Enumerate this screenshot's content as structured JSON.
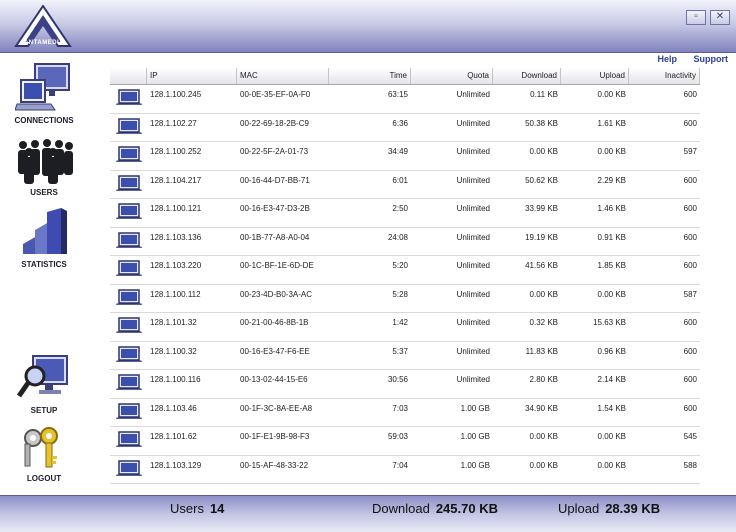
{
  "app": {
    "logo_text": "ANTAMEDIA"
  },
  "window_buttons": {
    "restore": "▫",
    "close": "✕"
  },
  "links": {
    "help": "Help",
    "support": "Support"
  },
  "sidebar": {
    "items": [
      {
        "label": "CONNECTIONS",
        "icon": "computer-icon"
      },
      {
        "label": "USERS",
        "icon": "users-icon"
      },
      {
        "label": "STATISTICS",
        "icon": "bar-chart-icon"
      },
      {
        "label": "SETUP",
        "icon": "setup-magnifier-icon"
      },
      {
        "label": "LOGOUT",
        "icon": "keys-icon"
      }
    ]
  },
  "table": {
    "columns": [
      "",
      "IP",
      "MAC",
      "Time",
      "Quota",
      "Download",
      "Upload",
      "Inactivity"
    ],
    "rows": [
      [
        "128.1.100.245",
        "00-0E-35-EF-0A-F0",
        "63:15",
        "Unlimited",
        "0.11 KB",
        "0.00 KB",
        "600"
      ],
      [
        "128.1.102.27",
        "00-22-69-18-2B-C9",
        "6:36",
        "Unlimited",
        "50.38 KB",
        "1.61 KB",
        "600"
      ],
      [
        "128.1.100.252",
        "00-22-5F-2A-01-73",
        "34:49",
        "Unlimited",
        "0.00 KB",
        "0.00 KB",
        "597"
      ],
      [
        "128.1.104.217",
        "00-16-44-D7-BB-71",
        "6:01",
        "Unlimited",
        "50.62 KB",
        "2.29 KB",
        "600"
      ],
      [
        "128.1.100.121",
        "00-16-E3-47-D3-2B",
        "2:50",
        "Unlimited",
        "33.99 KB",
        "1.46 KB",
        "600"
      ],
      [
        "128.1.103.136",
        "00-1B-77-A8-A0-04",
        "24:08",
        "Unlimited",
        "19.19 KB",
        "0.91 KB",
        "600"
      ],
      [
        "128.1.103.220",
        "00-1C-BF-1E-6D-DE",
        "5:20",
        "Unlimited",
        "41.56 KB",
        "1.85 KB",
        "600"
      ],
      [
        "128.1.100.112",
        "00-23-4D-B0-3A-AC",
        "5:28",
        "Unlimited",
        "0.00 KB",
        "0.00 KB",
        "587"
      ],
      [
        "128.1.101.32",
        "00-21-00-46-8B-1B",
        "1:42",
        "Unlimited",
        "0.32 KB",
        "15.63 KB",
        "600"
      ],
      [
        "128.1.100.32",
        "00-16-E3-47-F6-EE",
        "5:37",
        "Unlimited",
        "11.83 KB",
        "0.96 KB",
        "600"
      ],
      [
        "128.1.100.116",
        "00-13-02-44-15-E6",
        "30:56",
        "Unlimited",
        "2.80 KB",
        "2.14 KB",
        "600"
      ],
      [
        "128.1.103.46",
        "00-1F-3C-8A-EE-A8",
        "7:03",
        "1.00 GB",
        "34.90 KB",
        "1.54 KB",
        "600"
      ],
      [
        "128.1.101.62",
        "00-1F-E1-9B-98-F3",
        "59:03",
        "1.00 GB",
        "0.00 KB",
        "0.00 KB",
        "545"
      ],
      [
        "128.1.103.129",
        "00-15-AF-48-33-22",
        "7:04",
        "1.00 GB",
        "0.00 KB",
        "0.00 KB",
        "588"
      ]
    ]
  },
  "footer": {
    "users_label": "Users",
    "users_value": "14",
    "download_label": "Download",
    "download_value": "245.70 KB",
    "upload_label": "Upload",
    "upload_value": "28.39 KB"
  }
}
